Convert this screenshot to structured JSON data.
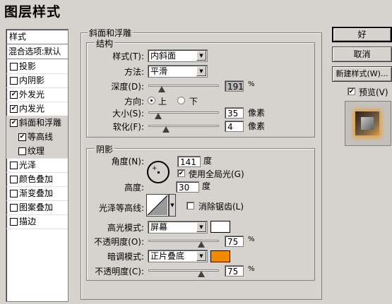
{
  "window": {
    "title": "图层样式"
  },
  "sidebar": {
    "header": "样式",
    "blend": "混合选项:默认",
    "items": [
      {
        "label": "投影",
        "checked": false
      },
      {
        "label": "内阴影",
        "checked": false
      },
      {
        "label": "外发光",
        "checked": true
      },
      {
        "label": "内发光",
        "checked": true
      },
      {
        "label": "斜面和浮雕",
        "checked": true
      },
      {
        "label": "等高线",
        "checked": true
      },
      {
        "label": "纹理",
        "checked": false
      },
      {
        "label": "光泽",
        "checked": false
      },
      {
        "label": "颜色叠加",
        "checked": false
      },
      {
        "label": "渐变叠加",
        "checked": false
      },
      {
        "label": "图案叠加",
        "checked": false
      },
      {
        "label": "描边",
        "checked": false
      }
    ]
  },
  "bevel": {
    "section_title": "斜面和浮雕",
    "structure_title": "结构",
    "style_label": "样式(T):",
    "style_value": "内斜面",
    "technique_label": "方法:",
    "technique_value": "平滑",
    "depth_label": "深度(D):",
    "depth_value": "191",
    "depth_unit": "%",
    "depth_level": 0.191,
    "direction_label": "方向:",
    "direction_up": "上",
    "direction_down": "下",
    "size_label": "大小(S):",
    "size_value": "35",
    "size_unit": "像素",
    "size_level": 0.14,
    "soften_label": "软化(F):",
    "soften_value": "4",
    "soften_unit": "像素",
    "soften_level": 0.25
  },
  "shading": {
    "title": "阴影",
    "angle_label": "角度(N):",
    "angle_value": "141",
    "angle_unit": "度",
    "global_light_label": "使用全局光(G)",
    "altitude_label": "高度:",
    "altitude_value": "30",
    "altitude_unit": "度",
    "gloss_label": "光泽等高线:",
    "antialias_label": "消除锯齿(L)",
    "highlight_label": "高光模式:",
    "highlight_value": "屏幕",
    "highlight_color": "#ffffff",
    "opacity1_label": "不透明度(O):",
    "opacity1_value": "75",
    "opacity1_unit": "%",
    "shadow_label": "暗调模式:",
    "shadow_value": "正片叠底",
    "shadow_color": "#f28a00",
    "opacity2_label": "不透明度(C):",
    "opacity2_value": "75",
    "opacity2_unit": "%"
  },
  "buttons": {
    "ok": "好",
    "cancel": "取消",
    "new_style": "新建样式(W)...",
    "preview": "预览(V)"
  }
}
